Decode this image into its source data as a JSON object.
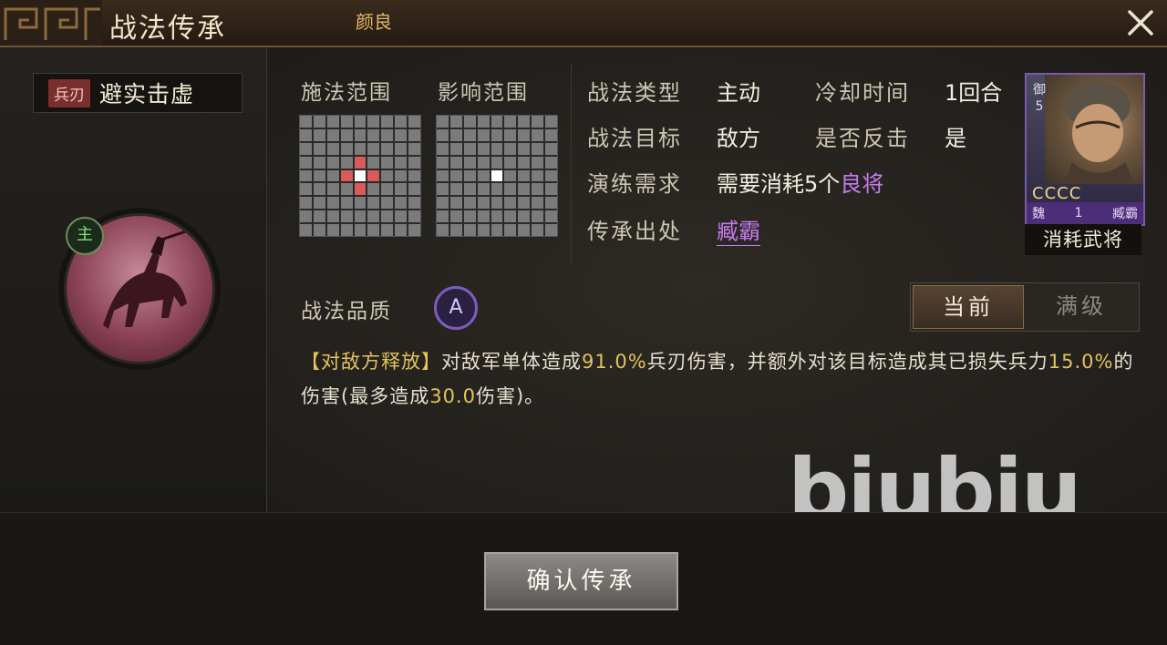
{
  "header": {
    "title": "战法传承",
    "general_name": "颜良",
    "close_label": "✕"
  },
  "skill": {
    "troop_type": "兵刃",
    "name": "避实击虚",
    "role_badge": "主"
  },
  "range": {
    "cast_label": "施法范围",
    "effect_label": "影响范围"
  },
  "info": {
    "type_label": "战法类型",
    "type_value": "主动",
    "cooldown_label": "冷却时间",
    "cooldown_value": "1回合",
    "target_label": "战法目标",
    "target_value": "敌方",
    "counter_label": "是否反击",
    "counter_value": "是",
    "train_label": "演练需求",
    "train_value_prefix": "需要消耗5个",
    "train_value_highlight": "良将",
    "source_label": "传承出处",
    "source_value": "臧霸"
  },
  "card": {
    "role": "御5",
    "stars": "CCCC",
    "faction": "魏",
    "level": "1",
    "name": "臧霸",
    "caption": "消耗武将"
  },
  "quality": {
    "label": "战法品质",
    "grade": "A"
  },
  "toggle": {
    "current": "当前",
    "max": "满级"
  },
  "description": {
    "tag": "【对敌方释放】",
    "p1": "对敌军单体造成",
    "v1": "91.0%",
    "p2": "兵刃伤害，并额外对该目标造成其已损失兵力",
    "v2": "15.0%",
    "p3": "的伤害(最多造成",
    "v3": "30.0",
    "p4": "伤害)。"
  },
  "watermark": "biubiu",
  "confirm_label": "确认传承",
  "colors": {
    "accent_purple": "#c77bf2",
    "accent_gold": "#e3c35a",
    "troop_tag": "#7a2e2e"
  }
}
